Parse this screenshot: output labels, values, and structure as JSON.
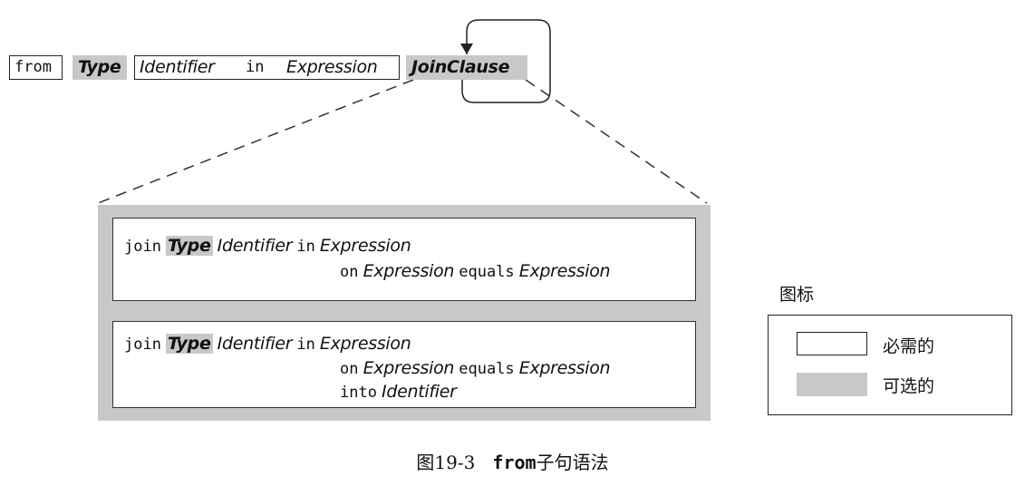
{
  "syntax": {
    "from": "from",
    "type": "Type",
    "identifier": "Identifier",
    "in": "in",
    "expression": "Expression",
    "join_clause": "JoinClause"
  },
  "clause1": {
    "join": "join",
    "type": "Type",
    "identifier": "Identifier",
    "in": "in",
    "expression1": "Expression",
    "on": "on",
    "expression2": "Expression",
    "equals": "equals",
    "expression3": "Expression"
  },
  "clause2": {
    "join": "join",
    "type": "Type",
    "identifier": "Identifier",
    "in": "in",
    "expression1": "Expression",
    "on": "on",
    "expression2": "Expression",
    "equals": "equals",
    "expression3": "Expression",
    "into": "into",
    "into_identifier": "Identifier"
  },
  "legend": {
    "title": "图标",
    "required": "必需的",
    "optional": "可选的",
    "colors": {
      "required": "#ffffff",
      "optional": "#c8c8c8"
    }
  },
  "caption": {
    "figure": "图19-3",
    "keyword": "from",
    "text": "子句语法"
  }
}
